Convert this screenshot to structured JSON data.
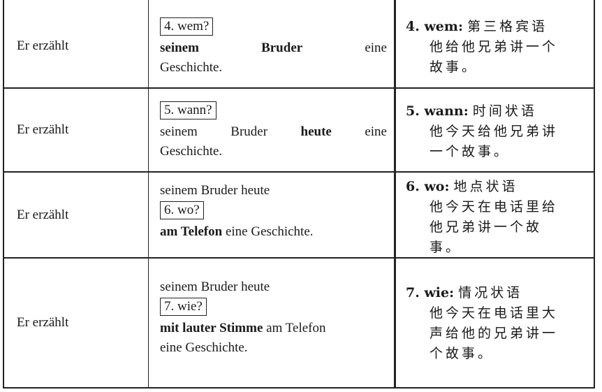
{
  "rows": [
    {
      "subject": "Er erzählt",
      "question": "4. wem?",
      "line1": [
        "seinem",
        "Bruder",
        "eine"
      ],
      "line2": "Geschichte.",
      "expl_label": "4. wem:",
      "expl_term": "第三格宾语",
      "expl_text": [
        "他给他兄弟讲一个",
        "故事。"
      ]
    },
    {
      "subject": "Er erzählt",
      "question": "5. wann?",
      "line1": [
        "seinem",
        "Bruder",
        "heute",
        "eine"
      ],
      "line2": "Geschichte.",
      "expl_label": "5. wann:",
      "expl_term": "时间状语",
      "expl_text": [
        "他今天给他兄弟讲",
        "一个故事。"
      ]
    },
    {
      "subject": "Er erzählt",
      "pre": "seinem Bruder heute",
      "question": "6. wo?",
      "bold": "am Telefon",
      "rest": "eine Geschichte.",
      "expl_label": "6. wo:",
      "expl_term": "地点状语",
      "expl_text": [
        "他今天在电话里给",
        "他兄弟讲一个故",
        "事。"
      ]
    },
    {
      "subject": "Er erzählt",
      "pre": "seinem Bruder heute",
      "question": "7. wie?",
      "bold": "mit lauter Stimme",
      "rest": "am Telefon",
      "line3": "eine Geschichte.",
      "expl_label": "7. wie:",
      "expl_term": "情况状语",
      "expl_text": [
        "他今天在电话里大",
        "声给他的兄弟讲一",
        "个故事。"
      ]
    }
  ]
}
